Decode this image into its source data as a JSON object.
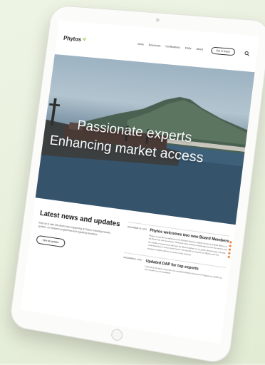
{
  "site": {
    "logo_text": "Phytos",
    "logo_mark": "✲"
  },
  "nav": {
    "items": [
      {
        "label": "News"
      },
      {
        "label": "Resources"
      },
      {
        "label": "Certifications"
      },
      {
        "label": "FAQs"
      },
      {
        "label": "About"
      }
    ],
    "cta_label": "Get in touch",
    "search_icon": "search-icon"
  },
  "hero": {
    "line1": "Passionate experts",
    "line2": "Enhancing market access"
  },
  "news": {
    "heading": "Latest news and updates",
    "description": "Keep up to date with what's been happening at Phytos, including industry updates, our research programmes and regulatory decisions.",
    "view_all_label": "View all updates",
    "articles": [
      {
        "date": "DECEMBER 14, 2023",
        "title": "Phytos welcomes two new Board Members",
        "body": "Phytos would like to welcome both Richard Hansen (Apple Grow) and Brad Wilson to the Board as new members. Richard's vast industry knowledge across the sector and his wealth of experience will help the Board deliver on its goals. Brad brings a broad understanding of sector governance and growth of exports for Phytos and his strategic insights will be an asset to the industry."
      },
      {
        "date": "DECEMBER 1, 2023",
        "title": "Updated DAP for top exports",
        "body": "Following the latest response, the updated Market Assurance Programme (DAP) for key exports is now available."
      }
    ]
  },
  "colors": {
    "accent": "#8cbf3f",
    "dots": "#e8823a"
  }
}
